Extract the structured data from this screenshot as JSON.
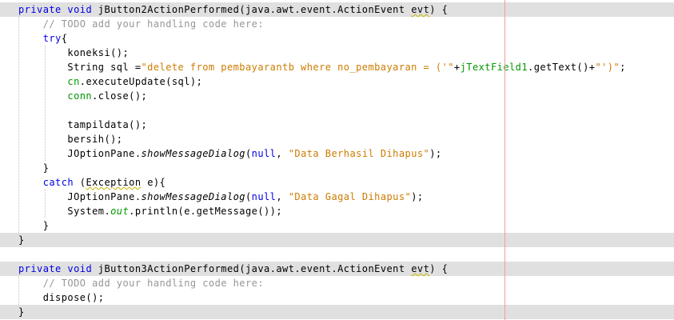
{
  "editor": {
    "lines": [
      [
        {
          "t": "private",
          "c": "kw"
        },
        {
          "t": " "
        },
        {
          "t": "void",
          "c": "kw"
        },
        {
          "t": " jButton2ActionPerformed(java.awt.event.ActionEvent "
        },
        {
          "t": "evt",
          "c": "u"
        },
        {
          "t": ") {"
        }
      ],
      [
        {
          "t": "    "
        },
        {
          "t": "// TODO add your handling code here:",
          "c": "cm"
        }
      ],
      [
        {
          "t": "    "
        },
        {
          "t": "try",
          "c": "kw"
        },
        {
          "t": "{"
        }
      ],
      [
        {
          "t": "        koneksi();"
        }
      ],
      [
        {
          "t": "        String sql ="
        },
        {
          "t": "\"delete from pembayarantb where no_pembayaran = ('\"",
          "c": "str"
        },
        {
          "t": "+"
        },
        {
          "t": "jTextField1",
          "c": "fld"
        },
        {
          "t": ".getText()+"
        },
        {
          "t": "\"')\"",
          "c": "str"
        },
        {
          "t": ";"
        }
      ],
      [
        {
          "t": "        "
        },
        {
          "t": "cn",
          "c": "fld"
        },
        {
          "t": ".executeUpdate(sql);"
        }
      ],
      [
        {
          "t": "        "
        },
        {
          "t": "conn",
          "c": "fld"
        },
        {
          "t": ".close();"
        }
      ],
      [
        {
          "t": ""
        }
      ],
      [
        {
          "t": "        tampildata();"
        }
      ],
      [
        {
          "t": "        bersih();"
        }
      ],
      [
        {
          "t": "        JOptionPane."
        },
        {
          "t": "showMessageDialog",
          "c": "it"
        },
        {
          "t": "("
        },
        {
          "t": "null",
          "c": "kw"
        },
        {
          "t": ", "
        },
        {
          "t": "\"Data Berhasil Dihapus\"",
          "c": "str"
        },
        {
          "t": ");"
        }
      ],
      [
        {
          "t": "    }"
        }
      ],
      [
        {
          "t": "    "
        },
        {
          "t": "catch",
          "c": "kw"
        },
        {
          "t": " ("
        },
        {
          "t": "Exception",
          "c": "u"
        },
        {
          "t": " e){"
        }
      ],
      [
        {
          "t": "        JOptionPane."
        },
        {
          "t": "showMessageDialog",
          "c": "it"
        },
        {
          "t": "("
        },
        {
          "t": "null",
          "c": "kw"
        },
        {
          "t": ", "
        },
        {
          "t": "\"Data Gagal Dihapus\"",
          "c": "str"
        },
        {
          "t": ");"
        }
      ],
      [
        {
          "t": "        System."
        },
        {
          "t": "out",
          "c": "fld it"
        },
        {
          "t": ".println(e.getMessage());"
        }
      ],
      [
        {
          "t": "    }"
        }
      ],
      [
        {
          "t": "}"
        }
      ],
      [
        {
          "t": ""
        }
      ],
      [
        {
          "t": "private",
          "c": "kw"
        },
        {
          "t": " "
        },
        {
          "t": "void",
          "c": "kw"
        },
        {
          "t": " jButton3ActionPerformed(java.awt.event.ActionEvent "
        },
        {
          "t": "evt",
          "c": "u"
        },
        {
          "t": ") {"
        }
      ],
      [
        {
          "t": "    "
        },
        {
          "t": "// TODO add your handling code here:",
          "c": "cm"
        }
      ],
      [
        {
          "t": "    dispose();"
        }
      ],
      [
        {
          "t": "}"
        }
      ]
    ],
    "highlighted_lines": [
      0,
      16,
      18,
      21
    ],
    "colors": {
      "keyword": "#0000e6",
      "comment": "#969696",
      "string": "#ce7b00",
      "field": "#009900",
      "highlight_bg": "#e0e0e0",
      "margin_line": "#e9a0a0"
    }
  }
}
